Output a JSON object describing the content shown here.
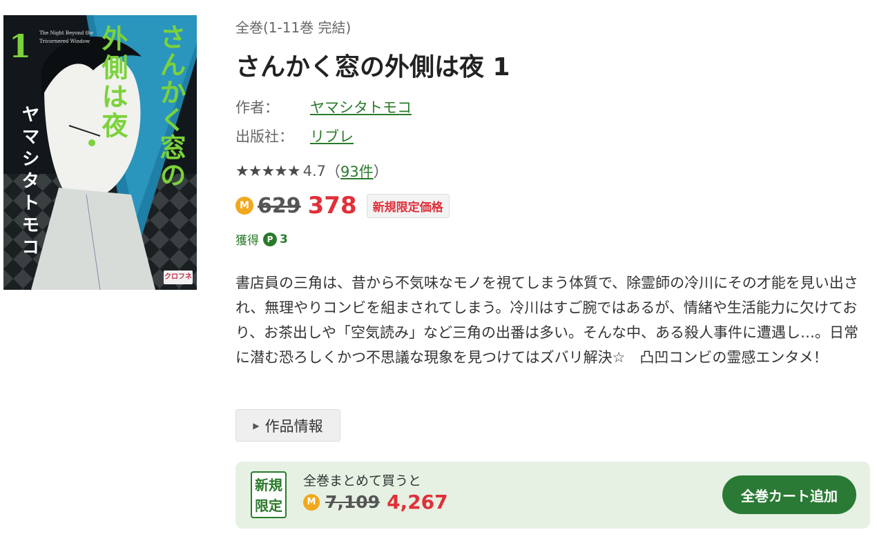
{
  "cover": {
    "volume": "1",
    "english_title": "The Night Beyond the Tricornered Window",
    "title_line1": "さんかく窓の",
    "title_line2": "外側は夜",
    "author": "ヤマシタトモコ",
    "label": "クロフネ"
  },
  "series": "全巻(1-11巻 完結)",
  "title": "さんかく窓の外側は夜 1",
  "author": {
    "label": "作者：",
    "name": "ヤマシタトモコ"
  },
  "publisher": {
    "label": "出版社：",
    "name": "リブレ"
  },
  "rating": {
    "stars": "★★★★★",
    "value": "4.7",
    "open": "（",
    "count": "93件",
    "close": "）"
  },
  "price": {
    "coin": "M",
    "original": "629",
    "sale": "378",
    "badge": "新規限定価格"
  },
  "points": {
    "label": "獲得",
    "coin": "P",
    "value": "3"
  },
  "description": "書店員の三角は、昔から不気味なモノを視てしまう体質で、除霊師の冷川にその才能を見い出され、無理やりコンビを組まされてしまう。冷川はすご腕ではあるが、情緒や生活能力に欠けており、お茶出しや「空気読み」など三角の出番は多い。そんな中、ある殺人事件に遭遇し…。日常に潜む恐ろしくかつ不思議な現象を見つけてはズバリ解決☆　凸凹コンビの霊感エンタメ！",
  "work_info": {
    "icon": "triangle-right-icon",
    "label": "作品情報"
  },
  "bundle": {
    "badge_line1": "新規",
    "badge_line2": "限定",
    "label": "全巻まとめて買うと",
    "coin": "M",
    "original": "7,109",
    "sale": "4,267",
    "button": "全巻カート追加"
  },
  "colors": {
    "accent_green": "#2a7a35",
    "sale_red": "#e0303a",
    "coin_orange": "#f2a81c",
    "bundle_bg": "#e6f1e3"
  }
}
